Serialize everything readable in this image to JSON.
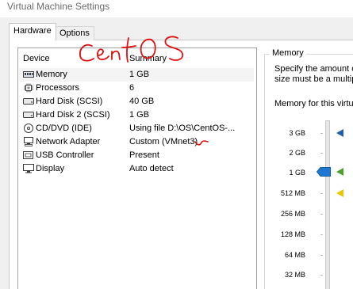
{
  "window": {
    "title": "Virtual Machine Settings"
  },
  "tabs": [
    {
      "label": "Hardware",
      "selected": true
    },
    {
      "label": "Options",
      "selected": false
    }
  ],
  "device_list": {
    "columns": {
      "device": "Device",
      "summary": "Summary"
    },
    "rows": [
      {
        "icon": "memory-icon",
        "device": "Memory",
        "summary": "1 GB",
        "selected": true
      },
      {
        "icon": "processor-icon",
        "device": "Processors",
        "summary": "6"
      },
      {
        "icon": "hard-disk-icon",
        "device": "Hard Disk (SCSI)",
        "summary": "40 GB"
      },
      {
        "icon": "hard-disk-icon",
        "device": "Hard Disk 2 (SCSI)",
        "summary": "1 GB"
      },
      {
        "icon": "cd-dvd-icon",
        "device": "CD/DVD (IDE)",
        "summary": "Using file D:\\OS\\CentOS-..."
      },
      {
        "icon": "network-adapter-icon",
        "device": "Network Adapter",
        "summary": "Custom (VMnet3)"
      },
      {
        "icon": "usb-icon",
        "device": "USB Controller",
        "summary": "Present"
      },
      {
        "icon": "display-icon",
        "device": "Display",
        "summary": "Auto detect"
      }
    ]
  },
  "annotation": {
    "text": "CentOS",
    "color": "#e01010"
  },
  "memory_panel": {
    "legend": "Memory",
    "description_line1": "Specify the amount of",
    "description_line2": "size must be a multip",
    "slider_label": "Memory for this virtu",
    "ticks": [
      "3 GB",
      "2 GB",
      "1 GB",
      "512 MB",
      "256 MB",
      "128 MB",
      "64 MB",
      "32 MB"
    ],
    "current_value": "1 GB",
    "markers": [
      {
        "name": "maximum-recommended",
        "at": "3 GB",
        "color": "#1e5fb4"
      },
      {
        "name": "recommended",
        "at": "1 GB",
        "color": "#4aa02c"
      },
      {
        "name": "guest-os-minimum",
        "at": "512 MB",
        "color": "#e6c800"
      }
    ]
  }
}
